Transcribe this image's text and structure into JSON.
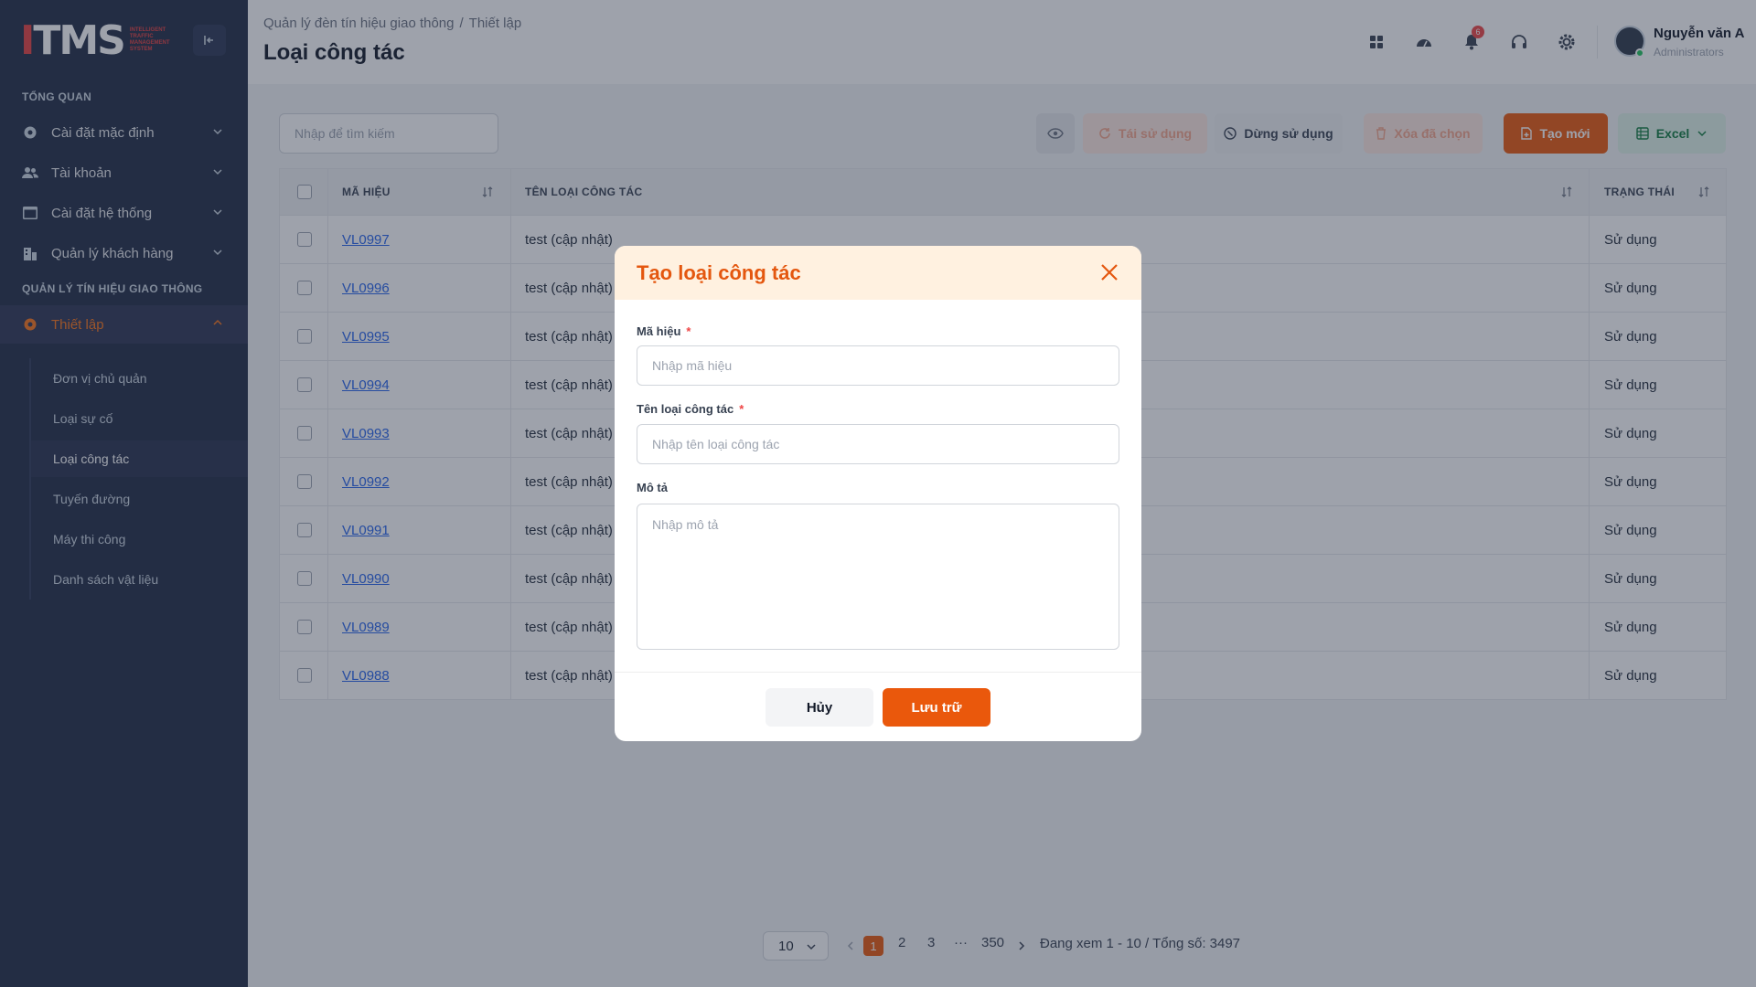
{
  "logo": {
    "main": "ITMS",
    "sub": [
      "INTELLIGENT",
      "TRAFFIC",
      "MANAGEMENT",
      "SYSTEM"
    ]
  },
  "sidebar": {
    "sections": [
      {
        "title": "TỔNG QUAN"
      },
      {
        "title": "QUẢN LÝ TÍN HIỆU GIAO THÔNG"
      }
    ],
    "items": [
      {
        "label": "Cài đặt mặc định"
      },
      {
        "label": "Tài khoản"
      },
      {
        "label": "Cài đặt hệ thống"
      },
      {
        "label": "Quản lý khách hàng"
      },
      {
        "label": "Thiết lập"
      }
    ],
    "subitems": [
      {
        "label": "Đơn vị chủ quản"
      },
      {
        "label": "Loại sự cố"
      },
      {
        "label": "Loại công tác"
      },
      {
        "label": "Tuyến đường"
      },
      {
        "label": "Máy thi công"
      },
      {
        "label": "Danh sách vật liệu"
      }
    ]
  },
  "header": {
    "breadcrumb": [
      "Quản lý đèn tín hiệu giao thông",
      "Thiết lập"
    ],
    "breadcrumb_sep": "/",
    "title": "Loại công tác",
    "notification_count": "6",
    "user": {
      "name": "Nguyễn văn A",
      "role": "Administrators"
    }
  },
  "toolbar": {
    "search_placeholder": "Nhập để tìm kiếm",
    "reuse_label": "Tái sử dụng",
    "stop_label": "Dừng sử dụng",
    "delete_label": "Xóa đã chọn",
    "new_label": "Tạo mới",
    "excel_label": "Excel"
  },
  "table": {
    "headers": {
      "code": "MÃ HIỆU",
      "name": "TÊN LOẠI CÔNG TÁC",
      "status": "TRẠNG THÁI"
    },
    "rows": [
      {
        "code": "VL0997",
        "name": "test (cập nhật)",
        "status": "Sử dụng"
      },
      {
        "code": "VL0996",
        "name": "test (cập nhật)",
        "status": "Sử dụng"
      },
      {
        "code": "VL0995",
        "name": "test (cập nhật)",
        "status": "Sử dụng"
      },
      {
        "code": "VL0994",
        "name": "test (cập nhật)",
        "status": "Sử dụng"
      },
      {
        "code": "VL0993",
        "name": "test (cập nhật)",
        "status": "Sử dụng"
      },
      {
        "code": "VL0992",
        "name": "test (cập nhật)",
        "status": "Sử dụng"
      },
      {
        "code": "VL0991",
        "name": "test (cập nhật)",
        "status": "Sử dụng"
      },
      {
        "code": "VL0990",
        "name": "test (cập nhật)",
        "status": "Sử dụng"
      },
      {
        "code": "VL0989",
        "name": "test (cập nhật)",
        "status": "Sử dụng"
      },
      {
        "code": "VL0988",
        "name": "test (cập nhật)",
        "status": "Sử dụng"
      }
    ]
  },
  "pagination": {
    "page_size": "10",
    "pages": [
      "1",
      "2",
      "3",
      "350"
    ],
    "ellipsis": "···",
    "current": "1",
    "info": "Đang xem 1 - 10 / Tổng số: 3497"
  },
  "modal": {
    "title": "Tạo loại công tác",
    "fields": {
      "code": {
        "label": "Mã hiệu",
        "required": "*",
        "placeholder": "Nhập mã hiệu",
        "value": ""
      },
      "name": {
        "label": "Tên loại công tác",
        "required": "*",
        "placeholder": "Nhập tên loại công tác",
        "value": ""
      },
      "description": {
        "label": "Mô tả",
        "placeholder": "Nhập mô tả",
        "value": ""
      }
    },
    "cancel_label": "Hủy",
    "save_label": "Lưu trữ"
  },
  "colors": {
    "accent": "#ea580c",
    "sidebar_bg": "#1f2a44",
    "link": "#2563eb",
    "modal_header": "#fff1e0"
  }
}
